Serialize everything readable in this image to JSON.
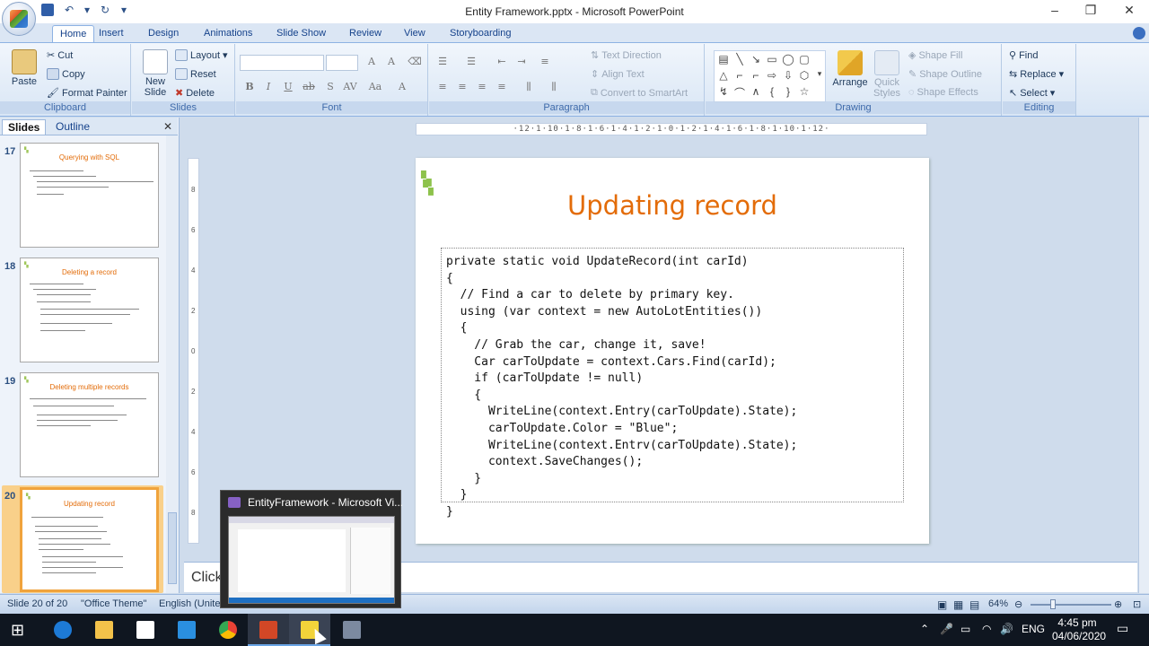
{
  "window": {
    "title": "Entity Framework.pptx - Microsoft PowerPoint",
    "controls": [
      "–",
      "❐",
      "✕"
    ]
  },
  "quick_access": [
    "save",
    "undo",
    "redo",
    "customize"
  ],
  "ribbon": {
    "tabs": [
      "Home",
      "Insert",
      "Design",
      "Animations",
      "Slide Show",
      "Review",
      "View",
      "Storyboarding"
    ],
    "active_tab": "Home",
    "clipboard": {
      "label": "Clipboard",
      "paste": "Paste",
      "cut": "Cut",
      "copy": "Copy",
      "format_painter": "Format Painter"
    },
    "slides": {
      "label": "Slides",
      "new_slide": "New Slide",
      "layout": "Layout",
      "reset": "Reset",
      "delete": "Delete"
    },
    "font": {
      "label": "Font"
    },
    "paragraph": {
      "label": "Paragraph",
      "text_direction": "Text Direction",
      "align_text": "Align Text",
      "convert_smartart": "Convert to SmartArt"
    },
    "drawing": {
      "label": "Drawing",
      "arrange": "Arrange",
      "quick_styles": "Quick Styles",
      "shape_fill": "Shape Fill",
      "shape_outline": "Shape Outline",
      "shape_effects": "Shape Effects"
    },
    "editing": {
      "label": "Editing",
      "find": "Find",
      "replace": "Replace",
      "select": "Select"
    }
  },
  "pane": {
    "tabs": [
      "Slides",
      "Outline"
    ],
    "thumbnails": [
      {
        "num": "17",
        "title": "Querying with SQL"
      },
      {
        "num": "18",
        "title": "Deleting a record"
      },
      {
        "num": "19",
        "title": "Deleting multiple records"
      },
      {
        "num": "20",
        "title": "Updating record"
      }
    ]
  },
  "ruler": {
    "horizontal": "·12·1·10·1·8·1·6·1·4·1·2·1·0·1·2·1·4·1·6·1·8·1·10·1·12·",
    "vertical": [
      "8",
      "6",
      "4",
      "2",
      "0",
      "2",
      "4",
      "6",
      "8"
    ]
  },
  "slide": {
    "title": "Updating record",
    "code": [
      "private static void UpdateRecord(int carId)",
      "{",
      "  // Find a car to delete by primary key.",
      "  using (var context = new AutoLotEntities())",
      "  {",
      "    // Grab the car, change it, save!",
      "    Car carToUpdate = context.Cars.Find(carId);",
      "    if (carToUpdate != null)",
      "    {",
      "      WriteLine(context.Entry(carToUpdate).State);",
      "      carToUpdate.Color = \"Blue\";",
      "      WriteLine(context.Entrv(carToUpdate).State);",
      "      context.SaveChanges();",
      "    }",
      "  }",
      "}"
    ]
  },
  "notes": {
    "text": "Click"
  },
  "taskbar_preview": {
    "title": "EntityFramework - Microsoft Vi..."
  },
  "status": {
    "slide": "Slide 20 of 20",
    "theme": "\"Office Theme\"",
    "language": "English (Unite",
    "zoom": "64%"
  },
  "tray": {
    "language": "ENG",
    "time": "4:45 pm",
    "date": "04/06/2020"
  },
  "colors": {
    "title_orange": "#e36c09",
    "ribbon_blue": "#15428b",
    "logo_green": "#8dc24b"
  }
}
